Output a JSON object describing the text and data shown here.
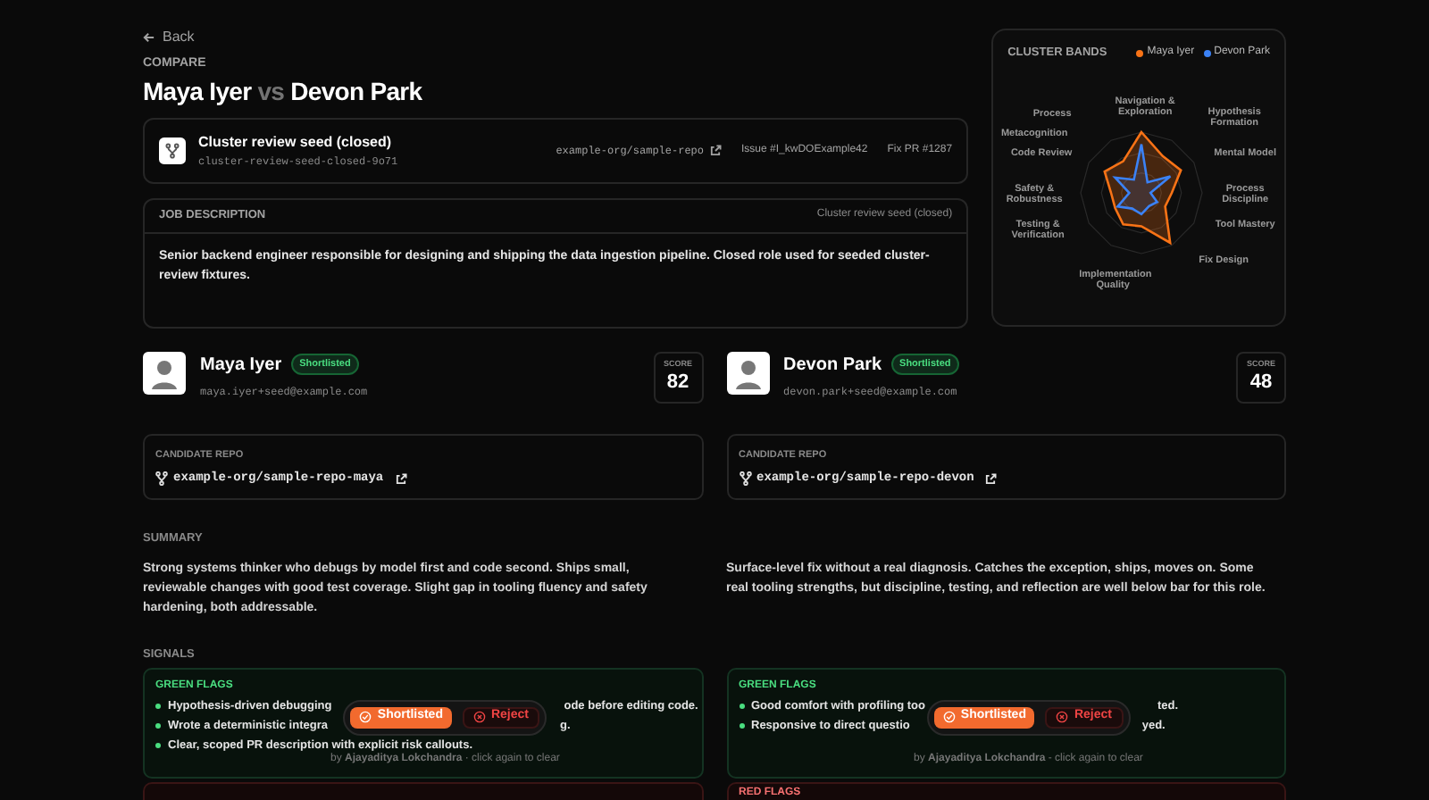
{
  "back": "Back",
  "eyebrow": "COMPARE",
  "title": {
    "a": "Maya Iyer",
    "vs": "vs",
    "b": "Devon Park"
  },
  "seed": {
    "name": "Cluster review seed (closed)",
    "slug": "cluster-review-seed-closed-9o71",
    "repo": "example-org/sample-repo",
    "issue": "Issue #I_kwDOExample42",
    "pr": "Fix PR #1287"
  },
  "job": {
    "heading": "JOB DESCRIPTION",
    "tag": "Cluster review seed (closed)",
    "text": "Senior backend engineer responsible for designing and shipping the data ingestion pipeline. Closed role used for seeded cluster-review fixtures."
  },
  "radar": {
    "title": "CLUSTER BANDS",
    "legend": [
      {
        "name": "Maya Iyer",
        "color": "#f97316"
      },
      {
        "name": "Devon Park",
        "color": "#3b82f6"
      }
    ],
    "axes": [
      "Process",
      "Navigation & Exploration",
      "Hypothesis Formation",
      "Metacognition",
      "Code Review",
      "Mental Model",
      "Safety & Robustness",
      "Process Discipline",
      "Testing & Verification",
      "Tool Mastery",
      "Fix Design",
      "Implementation Quality"
    ]
  },
  "candidates": [
    {
      "name": "Maya Iyer",
      "badge": "Shortlisted",
      "email": "maya.iyer+seed@example.com",
      "score_label": "SCORE",
      "score": "82",
      "repo_label": "CANDIDATE REPO",
      "repo": "example-org/sample-repo-maya",
      "summary": "Strong systems thinker who debugs by model first and code second. Ships small, reviewable changes with good test coverage. Slight gap in tooling fluency and safety hardening, both addressable.",
      "green": {
        "heading": "GREEN FLAGS",
        "items": [
          {
            "start": "Hypothesis-driven debugging",
            "end": "ode before editing code."
          },
          {
            "start": "Wrote a deterministic integra",
            "end": "g."
          },
          {
            "start": "Clear, scoped PR description with explicit risk callouts."
          }
        ]
      },
      "decision": {
        "buttons": [
          {
            "label": "Shortlisted",
            "kind": "accept",
            "selected": true
          },
          {
            "label": "Reject",
            "kind": "reject",
            "selected": false
          }
        ],
        "by": "by",
        "reviewer": "Ajayaditya Lokchandra",
        "hint": "· click again to clear"
      }
    },
    {
      "name": "Devon Park",
      "badge": "Shortlisted",
      "email": "devon.park+seed@example.com",
      "score_label": "SCORE",
      "score": "48",
      "repo_label": "CANDIDATE REPO",
      "repo": "example-org/sample-repo-devon",
      "summary": "Surface-level fix without a real diagnosis. Catches the exception, ships, moves on. Some real tooling strengths, but discipline, testing, and reflection are well below bar for this role.",
      "green": {
        "heading": "GREEN FLAGS",
        "items": [
          {
            "start": "Good comfort with profiling too",
            "end": "ted."
          },
          {
            "start": "Responsive to direct questio",
            "end": "yed."
          }
        ]
      },
      "red_heading": "RED FLAGS",
      "decision": {
        "buttons": [
          {
            "label": "Shortlisted",
            "kind": "accept",
            "selected": true
          },
          {
            "label": "Reject",
            "kind": "reject",
            "selected": false
          }
        ],
        "by": "by",
        "reviewer": "Ajayaditya Lokchandra",
        "hint": "- click again to clear"
      }
    }
  ],
  "summary_heading": "SUMMARY",
  "signals_heading": "SIGNALS"
}
